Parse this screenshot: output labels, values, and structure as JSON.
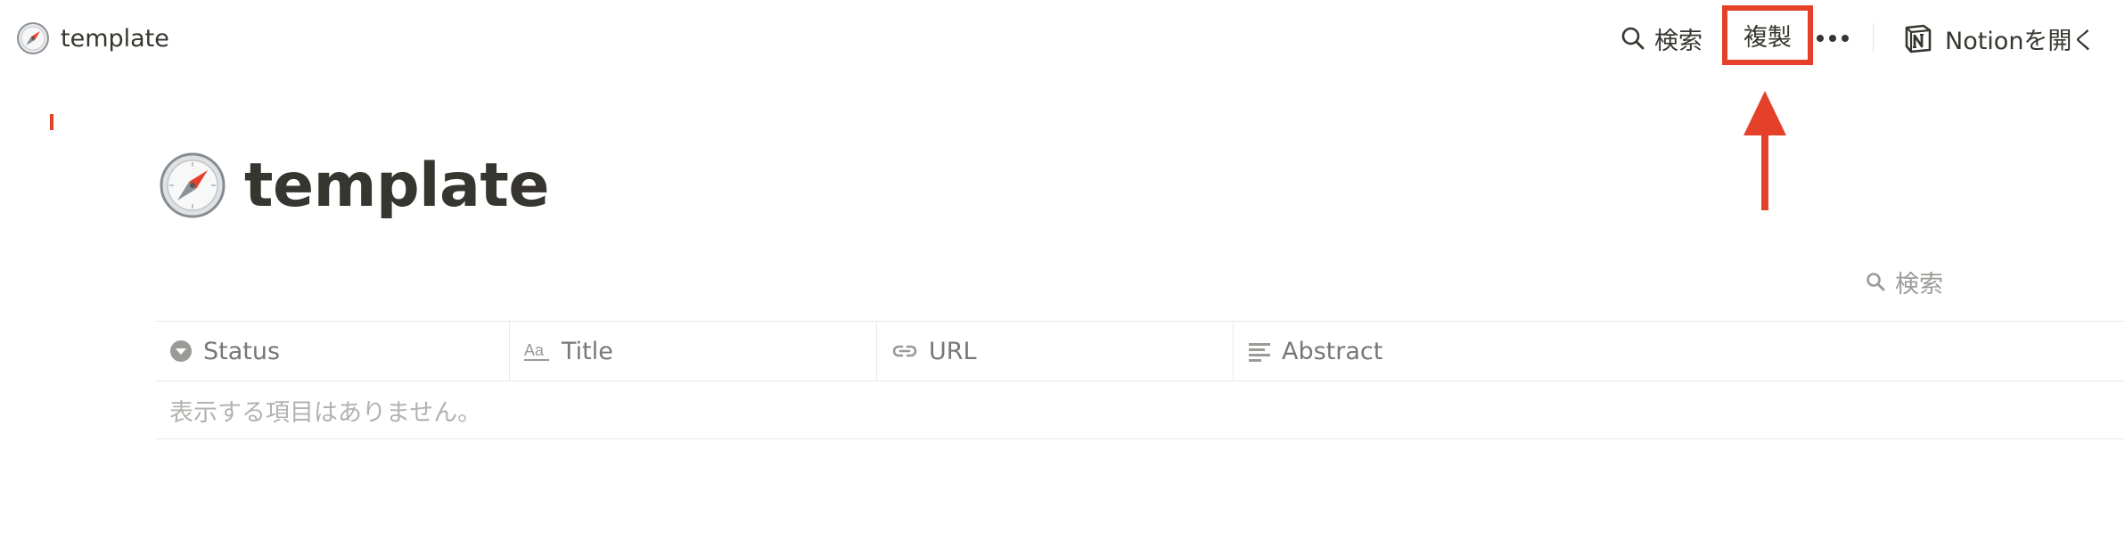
{
  "topbar": {
    "breadcrumb_label": "template",
    "search_label": "検索",
    "duplicate_label": "複製",
    "open_in_notion_label": "Notionを開く"
  },
  "page": {
    "title": "template"
  },
  "database": {
    "search_label": "検索",
    "columns": [
      {
        "label": "Status",
        "icon": "status-icon"
      },
      {
        "label": "Title",
        "icon": "text-aa-icon"
      },
      {
        "label": "URL",
        "icon": "link-icon"
      },
      {
        "label": "Abstract",
        "icon": "text-lines-icon"
      }
    ],
    "empty_message": "表示する項目はありません。"
  },
  "colors": {
    "highlight": "#e5402a",
    "text": "#37352f",
    "muted": "#787774",
    "placeholder": "#b3b2af"
  },
  "icons": {
    "breadcrumb": "compass-icon",
    "page": "compass-icon",
    "search": "search-icon",
    "more": "more-icon",
    "notion": "notion-logo-icon",
    "annotation": "arrow-up-icon"
  }
}
